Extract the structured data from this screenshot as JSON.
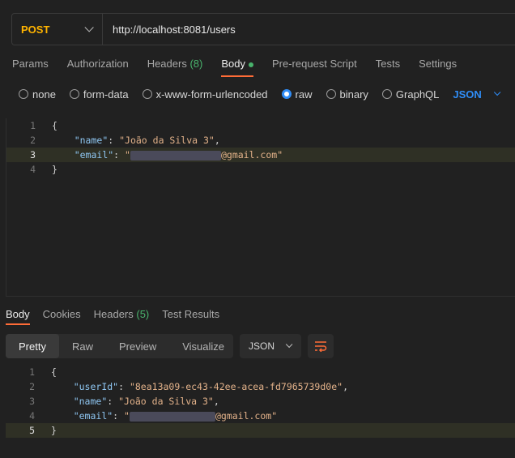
{
  "request": {
    "method": "POST",
    "url": "http://localhost:8081/users"
  },
  "tabs": [
    {
      "label": "Params"
    },
    {
      "label": "Authorization"
    },
    {
      "label": "Headers",
      "count": "(8)"
    },
    {
      "label": "Body"
    },
    {
      "label": "Pre-request Script"
    },
    {
      "label": "Tests"
    },
    {
      "label": "Settings"
    }
  ],
  "body_types": [
    "none",
    "form-data",
    "x-www-form-urlencoded",
    "raw",
    "binary",
    "GraphQL"
  ],
  "body_lang": "JSON",
  "request_body": {
    "line_numbers": [
      "1",
      "2",
      "3",
      "4"
    ],
    "open_brace": "{",
    "name_key": "\"name\"",
    "name_value": "\"João da Silva 3\"",
    "email_key": "\"email\"",
    "email_prefix": "\"",
    "email_suffix": "@gmail.com\"",
    "close_brace": "}"
  },
  "response_tabs": [
    {
      "label": "Body"
    },
    {
      "label": "Cookies"
    },
    {
      "label": "Headers",
      "count": "(5)"
    },
    {
      "label": "Test Results"
    }
  ],
  "view_modes": [
    "Pretty",
    "Raw",
    "Preview",
    "Visualize"
  ],
  "response_format": "JSON",
  "response_body": {
    "line_numbers": [
      "1",
      "2",
      "3",
      "4",
      "5"
    ],
    "open_brace": "{",
    "userid_key": "\"userId\"",
    "userid_value": "\"8ea13a09-ec43-42ee-acea-fd7965739d0e\"",
    "name_key": "\"name\"",
    "name_value": "\"João da Silva 3\"",
    "email_key": "\"email\"",
    "email_prefix": "\"",
    "email_suffix": "@gmail.com\"",
    "close_brace": "}"
  },
  "colors": {
    "method": "#ffb400",
    "accent": "#ff6c37",
    "selected": "#2f8df7",
    "count": "#49b36c"
  }
}
